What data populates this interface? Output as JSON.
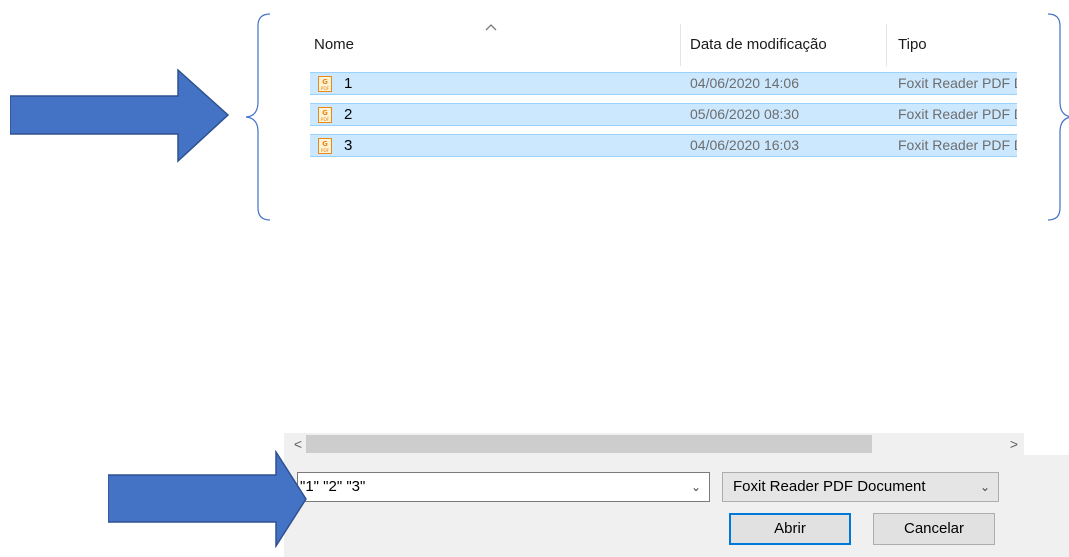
{
  "columns": {
    "name": "Nome",
    "date": "Data de modificação",
    "type": "Tipo"
  },
  "files": [
    {
      "name": "1",
      "date": "04/06/2020 14:06",
      "type": "Foxit Reader PDF Document",
      "icon": "foxit-pdf-icon"
    },
    {
      "name": "2",
      "date": "05/06/2020 08:30",
      "type": "Foxit Reader PDF Document",
      "icon": "foxit-pdf-icon"
    },
    {
      "name": "3",
      "date": "04/06/2020 16:03",
      "type": "Foxit Reader PDF Document",
      "icon": "foxit-pdf-icon"
    }
  ],
  "scrollbar": {
    "left": "<",
    "right": ">"
  },
  "filename": {
    "value": "\"1\" \"2\" \"3\""
  },
  "filetype": {
    "selected": "Foxit Reader PDF Document"
  },
  "buttons": {
    "open": "Abrir",
    "cancel": "Cancelar"
  },
  "colors": {
    "selection": "#cce8ff",
    "selection_border": "#99d1ff",
    "arrow": "#4472c4",
    "brace": "#4472c4",
    "accent": "#0078d7"
  }
}
